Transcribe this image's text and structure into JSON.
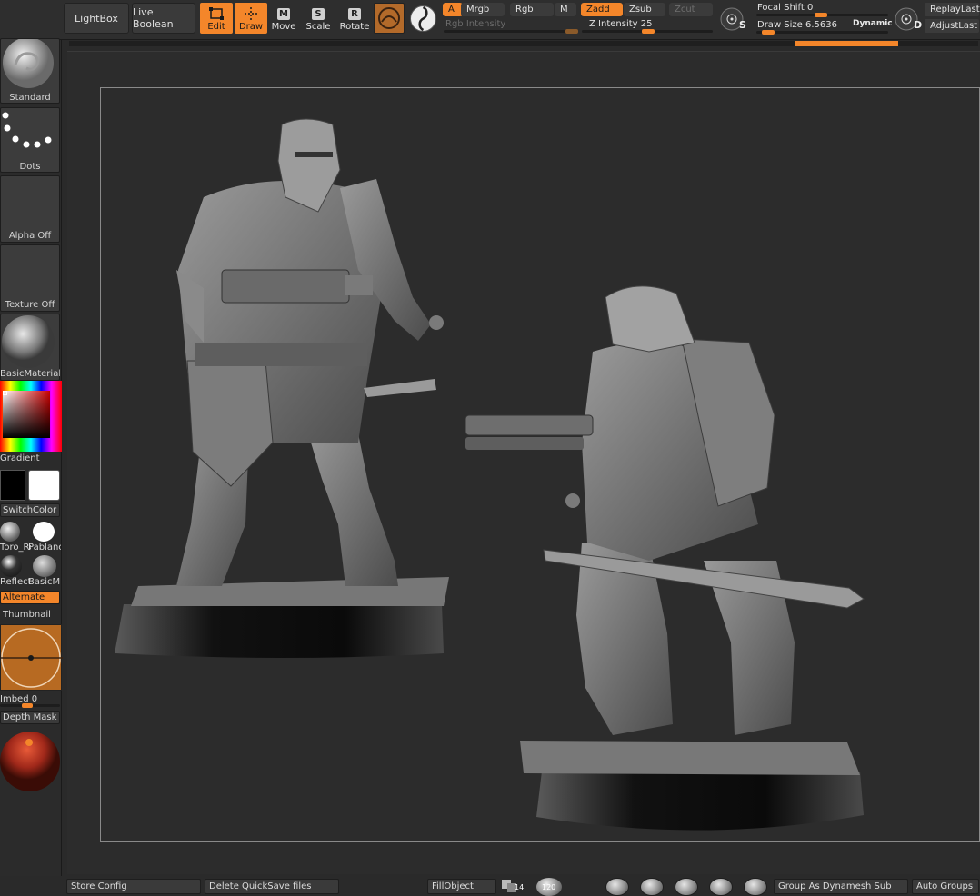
{
  "toolbar": {
    "lightbox": "LightBox",
    "live_boolean": "Live Boolean",
    "tools": [
      {
        "label": "Edit",
        "key": "",
        "active": true
      },
      {
        "label": "Draw",
        "key": "",
        "active": true
      },
      {
        "label": "Move",
        "key": "M",
        "active": false
      },
      {
        "label": "Scale",
        "key": "S",
        "active": false
      },
      {
        "label": "Rotate",
        "key": "R",
        "active": false
      }
    ],
    "channels": {
      "a": "A",
      "mrgb": "Mrgb",
      "rgb": "Rgb",
      "m": "M",
      "zadd": "Zadd",
      "zsub": "Zsub",
      "zcut": "Zcut"
    },
    "rgb_intensity_label": "Rgb Intensity",
    "z_intensity_label": "Z Intensity 25",
    "z_intensity_value": 25,
    "sym_s_key": "S",
    "focal_shift_label": "Focal Shift",
    "focal_shift_value": "0",
    "draw_size_label": "Draw Size",
    "draw_size_value": "6.5636",
    "dynamic_label": "Dynamic",
    "sym_d_key": "D",
    "replay_last": "ReplayLast",
    "adjust_last": "AdjustLast"
  },
  "left_panel": {
    "brush_label": "Standard",
    "stroke_label": "Dots",
    "alpha_label": "Alpha Off",
    "texture_label": "Texture Off",
    "material_label": "BasicMaterial",
    "gradient_label": "Gradient",
    "switch_color_label": "SwitchColor",
    "mat_a_label": "Toro_Re",
    "mat_b_label": "Pablanc",
    "mat_c_label": "Reflect",
    "mat_d_label": "BasicM",
    "alternate_label": "Alternate",
    "thumbnail_label": "Thumbnail",
    "imbed_label": "Imbed",
    "imbed_value": "0",
    "depth_mask_label": "Depth Mask"
  },
  "bottom_bar": {
    "store_config": "Store Config",
    "delete_quicksave": "Delete QuickSave files",
    "fill_object": "FillObject",
    "count_a": "14",
    "count_b": "120",
    "group_dynamesh": "Group As Dynamesh Sub",
    "auto_groups": "Auto Groups"
  },
  "colors": {
    "accent": "#f4862a",
    "panel": "#2e2e2e",
    "button": "#3a3a3a",
    "canvas": "#2c2c2c",
    "model": "#6b6b6b"
  }
}
